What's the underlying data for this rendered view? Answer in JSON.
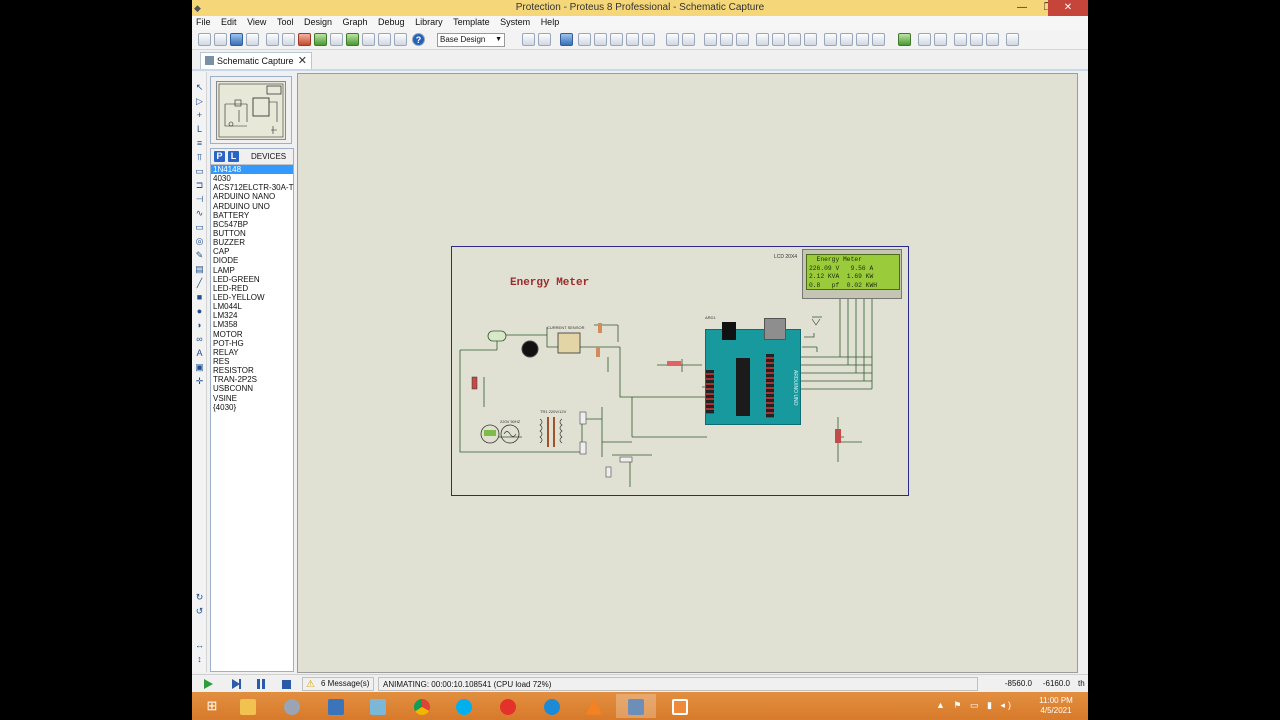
{
  "window": {
    "title": "Protection - Proteus 8 Professional - Schematic Capture"
  },
  "menu": [
    "File",
    "Edit",
    "View",
    "Tool",
    "Design",
    "Graph",
    "Debug",
    "Library",
    "Template",
    "System",
    "Help"
  ],
  "toolbar": {
    "design_select": "Base Design"
  },
  "tabs": [
    {
      "label": "Schematic Capture"
    }
  ],
  "devices": {
    "title": "DEVICES",
    "pick_label": "P",
    "lib_label": "L",
    "items": [
      "1N4148",
      "4030",
      "ACS712ELCTR-30A-T",
      "ARDUINO NANO",
      "ARDUINO UNO",
      "BATTERY",
      "BC547BP",
      "BUTTON",
      "BUZZER",
      "CAP",
      "DIODE",
      "LAMP",
      "LED-GREEN",
      "LED-RED",
      "LED-YELLOW",
      "LM044L",
      "LM324",
      "LM358",
      "MOTOR",
      "POT-HG",
      "RELAY",
      "RES",
      "RESISTOR",
      "TRAN-2P2S",
      "USBCONN",
      "VSINE",
      "{4030}"
    ],
    "selected": "1N4148"
  },
  "schematic": {
    "title": "Energy Meter",
    "lcd_ref": "LCD 20X4",
    "lcd_lines": [
      "  Energy Meter",
      "226.09 V   9.56 A",
      "2.12 KVA  1.69 KW",
      "0.8   pf  0.02 KWH"
    ],
    "arduino_ref": "ARD1",
    "arduino_label": "ARDUINO UNO",
    "current_sensor_label": "CURRENT SENSOR",
    "transformer_label": "TR1  220V/12V",
    "source_label": "220V 50HZ"
  },
  "status": {
    "messages": "6 Message(s)",
    "animating": "ANIMATING: 00:00:10.108541 (CPU load 72%)",
    "coord_x": "-8560.0",
    "coord_y": "-6160.0",
    "units": "th"
  },
  "taskbar": {
    "time": "11:00 PM",
    "date": "4/5/2021"
  }
}
